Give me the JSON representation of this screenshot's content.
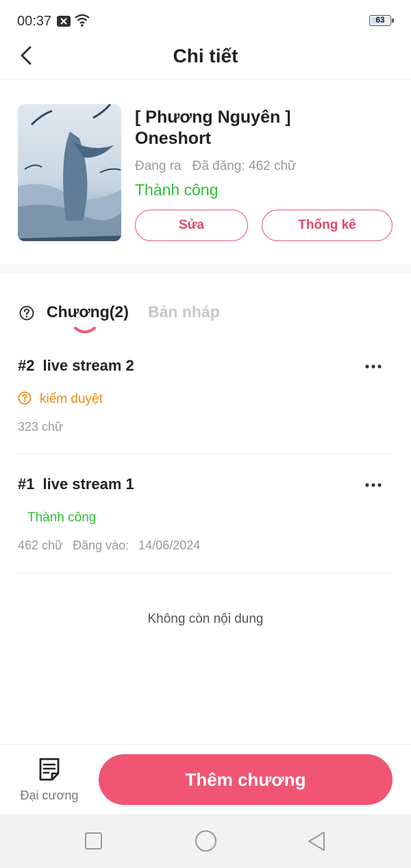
{
  "status_bar": {
    "time": "00:37",
    "battery": "63"
  },
  "header": {
    "title": "Chi tiết"
  },
  "book": {
    "title_line1": "[ Phương Nguyên ]",
    "title_line2": "Oneshort",
    "state": "Đang ra",
    "posted": "Đã đăng: 462 chữ",
    "status": "Thành công",
    "edit_label": "Sửa",
    "stats_label": "Thống kê"
  },
  "tabs": {
    "chapters_label": "Chương(2)",
    "drafts_label": "Bản nháp"
  },
  "chapters": [
    {
      "number": "#2",
      "title": "live stream 2",
      "status": "kiểm duyệt",
      "words": "323 chữ"
    },
    {
      "number": "#1",
      "title": "live stream 1",
      "status": "Thành công",
      "words": "462 chữ",
      "posted_label": "Đăng vào:",
      "posted_date": "14/06/2024"
    }
  ],
  "end_message": "Không còn nội dung",
  "bottom_bar": {
    "outline_label": "Đại cương",
    "add_chapter_label": "Thêm chương"
  },
  "colors": {
    "accent": "#f05673",
    "success": "#2fbf38",
    "warning": "#ef8a13"
  },
  "icons": [
    "back-arrow-icon",
    "help-circle-icon",
    "more-dots-icon",
    "note-document-icon",
    "nav-square-icon",
    "nav-home-icon",
    "nav-back-icon"
  ]
}
